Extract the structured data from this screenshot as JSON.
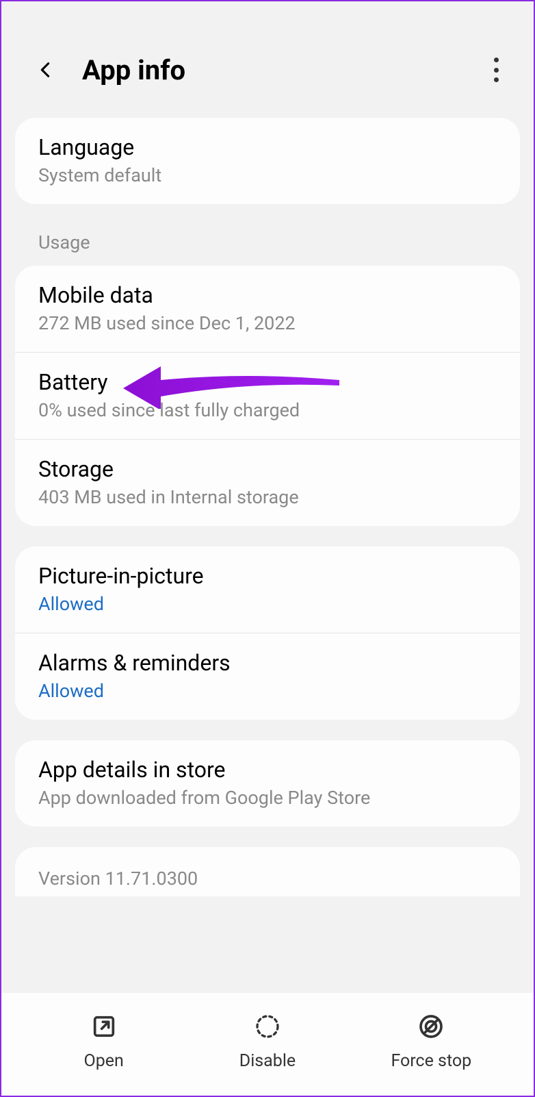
{
  "header": {
    "title": "App info"
  },
  "language": {
    "title": "Language",
    "value": "System default"
  },
  "usage_label": "Usage",
  "mobile_data": {
    "title": "Mobile data",
    "subtitle": "272 MB used since Dec 1, 2022"
  },
  "battery": {
    "title": "Battery",
    "subtitle": "0% used since last fully charged"
  },
  "storage": {
    "title": "Storage",
    "subtitle": "403 MB used in Internal storage"
  },
  "pip": {
    "title": "Picture-in-picture",
    "status": "Allowed"
  },
  "alarms": {
    "title": "Alarms & reminders",
    "status": "Allowed"
  },
  "app_details": {
    "title": "App details in store",
    "subtitle": "App downloaded from Google Play Store"
  },
  "version": "Version 11.71.0300",
  "bottom": {
    "open": "Open",
    "disable": "Disable",
    "force_stop": "Force stop"
  },
  "annotation": {
    "arrow_color": "#8c0fd4"
  }
}
